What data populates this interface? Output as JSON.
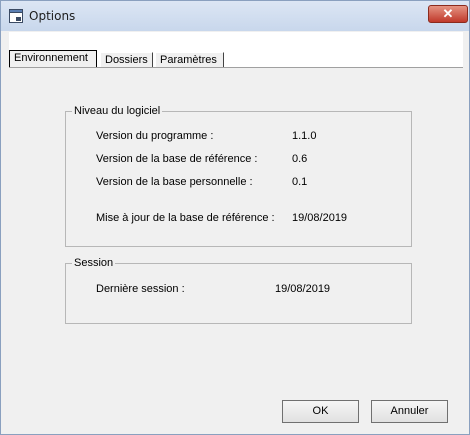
{
  "window": {
    "title": "Options",
    "close_glyph": "✕"
  },
  "tabs": [
    {
      "label": "Environnement",
      "active": true
    },
    {
      "label": "Dossiers",
      "active": false
    },
    {
      "label": "Paramètres",
      "active": false
    }
  ],
  "software_group": {
    "legend": "Niveau du logiciel",
    "rows": [
      {
        "label": "Version du programme :",
        "value": "1.1.0"
      },
      {
        "label": "Version de la base de référence :",
        "value": "0.6"
      },
      {
        "label": "Version de la base personnelle :",
        "value": "0.1"
      },
      {
        "label": "Mise à jour de la base de référence :",
        "value": "19/08/2019"
      }
    ]
  },
  "session_group": {
    "legend": "Session",
    "rows": [
      {
        "label": "Dernière session :",
        "value": "19/08/2019"
      }
    ]
  },
  "buttons": {
    "ok": "OK",
    "cancel": "Annuler"
  },
  "colors": {
    "title_bar": "#c8d7ec",
    "close_button": "#c0392b",
    "dialog_background": "#f0f0f0"
  },
  "icons": {
    "app": "window-icon",
    "close": "close-icon"
  }
}
